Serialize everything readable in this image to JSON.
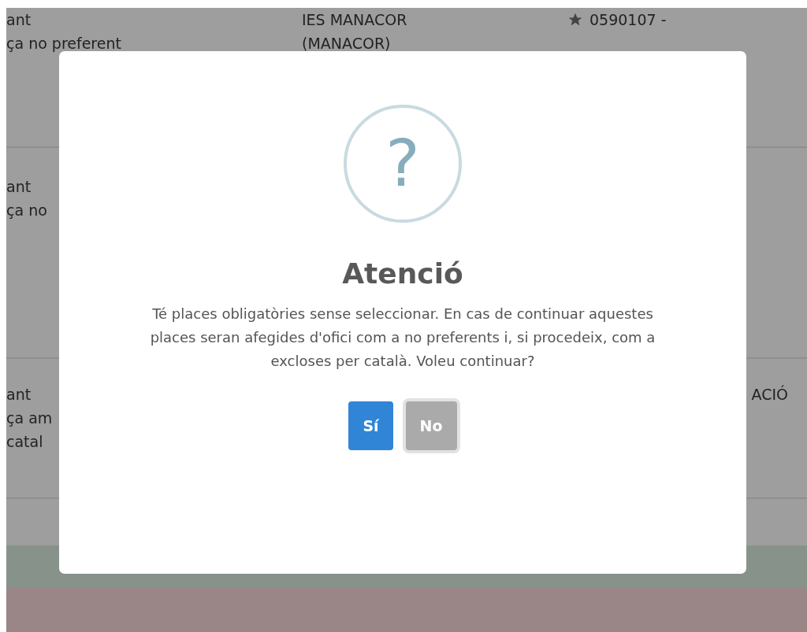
{
  "table": {
    "rows": [
      {
        "cells": [
          {
            "lines": [
              "ant",
              "ça no preferent"
            ]
          },
          {
            "lines": [
              "IES MANACOR",
              "(MANACOR)"
            ]
          },
          {
            "starred": true,
            "lines": [
              "0590107 -"
            ]
          }
        ]
      },
      {
        "cells": [
          {
            "lines": [
              "ant",
              "ça no"
            ]
          },
          {},
          {}
        ]
      },
      {
        "cells": [
          {
            "lines": [
              "ant",
              "ça am",
              "catal"
            ]
          },
          {},
          {
            "lines": [
              "ACIÓ"
            ]
          }
        ]
      }
    ]
  },
  "dialog": {
    "icon_glyph": "?",
    "title": "Atenció",
    "message": "Té places obligatòries sense seleccionar. En cas de continuar aquestes places seran afegides d'ofici com a no preferents i, si procedeix, com a excloses per català. Voleu continuar?",
    "buttons": [
      {
        "kind": "confirm",
        "label": "Sí",
        "focused": false
      },
      {
        "kind": "cancel",
        "label": "No",
        "focused": true
      }
    ]
  }
}
